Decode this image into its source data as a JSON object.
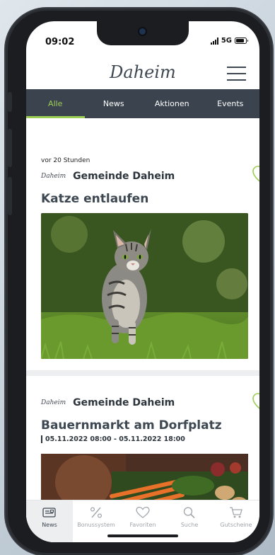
{
  "status_bar": {
    "time": "09:02",
    "network": "5G"
  },
  "header": {
    "logo": "Daheim",
    "menu_icon": "hamburger-menu-icon"
  },
  "tabs": [
    {
      "label": "Alle",
      "active": true
    },
    {
      "label": "News",
      "active": false
    },
    {
      "label": "Aktionen",
      "active": false
    },
    {
      "label": "Events",
      "active": false
    }
  ],
  "feed": [
    {
      "time": "vor 20 Stunden",
      "brand": "Daheim",
      "publisher": "Gemeinde Daheim",
      "title": "Katze entlaufen",
      "image": "cat-photo"
    },
    {
      "brand": "Daheim",
      "publisher": "Gemeinde Daheim",
      "title": "Bauernmarkt am Dorfplatz",
      "date": "05.11.2022 08:00 - 05.11.2022 18:00",
      "image": "market-vegetables-photo"
    }
  ],
  "bottom_nav": [
    {
      "label": "News",
      "icon": "newspaper-icon",
      "active": true
    },
    {
      "label": "Bonussystem",
      "icon": "percent-icon",
      "active": false
    },
    {
      "label": "Favoriten",
      "icon": "heart-icon",
      "active": false
    },
    {
      "label": "Suche",
      "icon": "search-icon",
      "active": false
    },
    {
      "label": "Gutscheine",
      "icon": "cart-icon",
      "active": false
    }
  ],
  "colors": {
    "accent": "#9ccd55",
    "tab_bar": "#3b444e",
    "text": "#3e4852"
  }
}
